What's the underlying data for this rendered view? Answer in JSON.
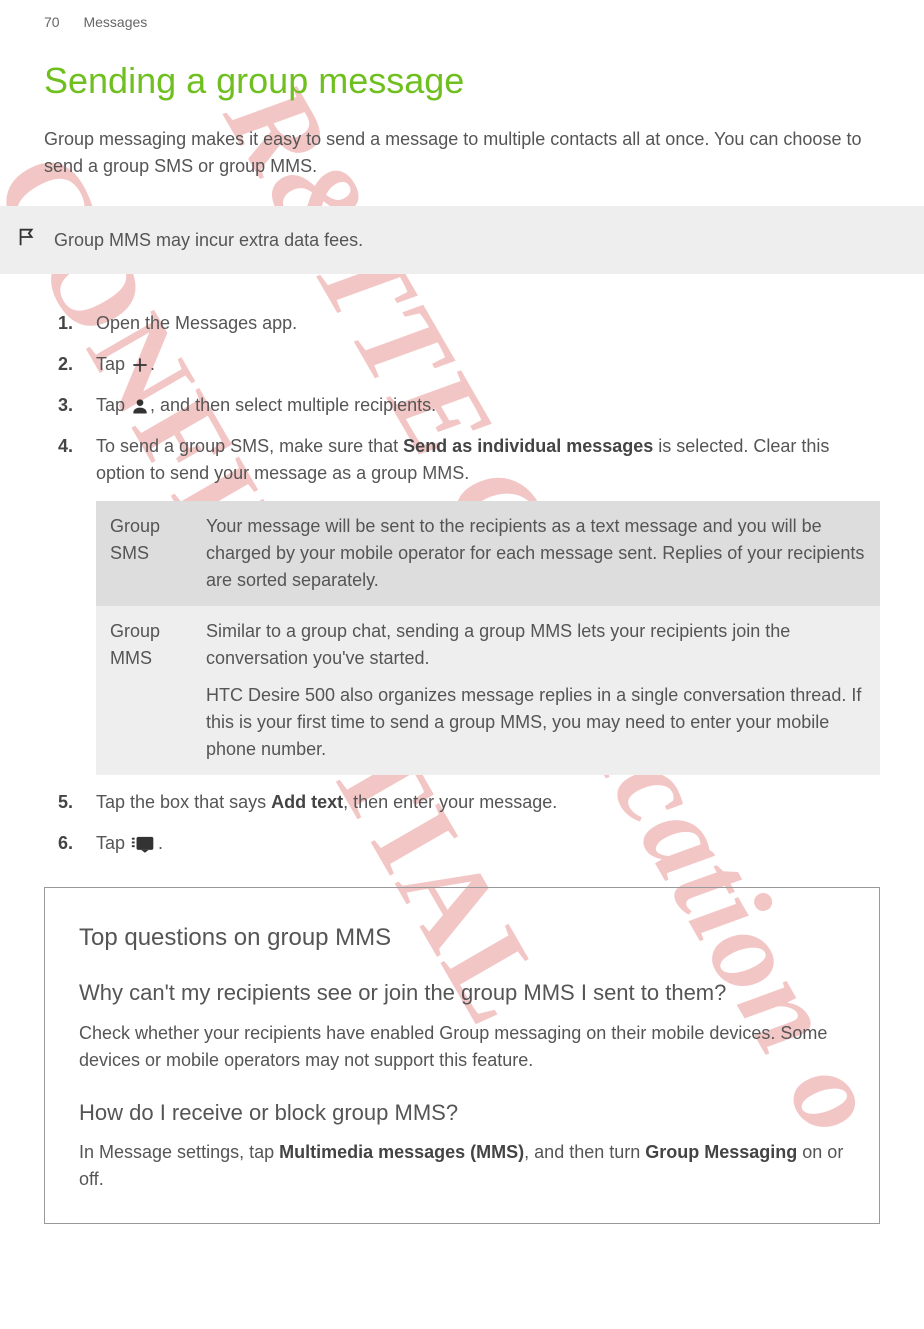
{
  "header": {
    "page_number": "70",
    "section": "Messages"
  },
  "title": "Sending a group message",
  "intro": "Group messaging makes it easy to send a message to multiple contacts all at once. You can choose to send a group SMS or group MMS.",
  "note": {
    "icon_name": "flag-icon",
    "text": "Group MMS may incur extra data fees."
  },
  "steps": {
    "s1": "Open the Messages app.",
    "s2_a": "Tap ",
    "s2_b": ".",
    "s3_a": "Tap ",
    "s3_b": ", and then select multiple recipients.",
    "s4_a": "To send a group SMS, make sure that ",
    "s4_bold": "Send as individual messages",
    "s4_b": " is selected. Clear this option to send your message as a group MMS.",
    "s5_a": "Tap the box that says ",
    "s5_bold": "Add text",
    "s5_b": ", then enter your message.",
    "s6_a": "Tap ",
    "s6_b": "."
  },
  "table": {
    "row1": {
      "label": "Group SMS",
      "desc": "Your message will be sent to the recipients as a text message and you will be charged by your mobile operator for each message sent. Replies of your recipients are sorted separately."
    },
    "row2": {
      "label": "Group MMS",
      "desc1": "Similar to a group chat, sending a group MMS lets your recipients join the conversation you've started.",
      "desc2": "HTC Desire 500 also organizes message replies in a single conversation thread. If this is your first time to send a group MMS, you may need to enter your mobile phone number."
    }
  },
  "faq": {
    "heading": "Top questions on group MMS",
    "q1": "Why can't my recipients see or join the group MMS I sent to them?",
    "a1": "Check whether your recipients have enabled Group messaging on their mobile devices. Some devices or mobile operators may not support this feature.",
    "q2": "How do I receive or block group MMS?",
    "a2_a": "In Message settings, tap ",
    "a2_bold1": "Multimedia messages (MMS)",
    "a2_b": ", and then turn ",
    "a2_bold2": "Group Messaging",
    "a2_c": " on or off."
  },
  "watermarks": {
    "wm1": "CONFIDENTIAL",
    "wm2": "R&TTE Certification o"
  }
}
